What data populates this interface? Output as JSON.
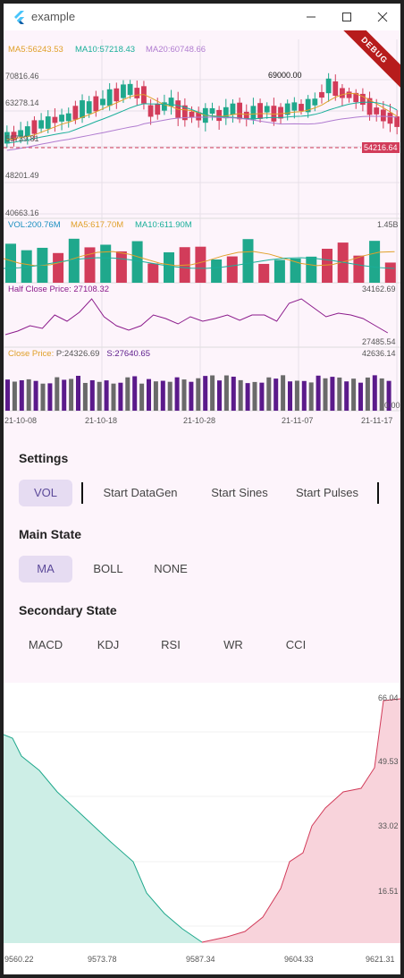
{
  "window": {
    "title": "example",
    "controls": [
      "minimize",
      "maximize",
      "close"
    ]
  },
  "debug_banner": "DEBUG",
  "main_chart": {
    "legend": [
      {
        "label": "MA5:56243.53",
        "color": "#e0a02a"
      },
      {
        "label": "MA10:57218.43",
        "color": "#1aaf9a"
      },
      {
        "label": "MA20:60748.66",
        "color": "#b07cd0"
      }
    ],
    "y_labels": [
      "70816.46",
      "63278.14",
      "55739.81",
      "48201.49",
      "40663.16"
    ],
    "high_label": "69000.00",
    "current_price": "54216.64",
    "colors": {
      "up": "#1fa88c",
      "down": "#d23c5a",
      "ma5": "#e0a02a",
      "ma10": "#1aaf9a",
      "ma20": "#b07cd0"
    }
  },
  "volume_chart": {
    "legend": [
      {
        "label": "VOL:200.76M",
        "color": "#1a8fc0"
      },
      {
        "label": "MA5:617.70M",
        "color": "#e0a02a"
      },
      {
        "label": "MA10:611.90M",
        "color": "#1aaf9a"
      }
    ],
    "max_label": "1.45B"
  },
  "half_close_chart": {
    "legend": "Half Close Price: 27108.32",
    "legend_color": "#8b1a8b",
    "max_label": "34162.69",
    "min_label": "27485.54"
  },
  "close_chart": {
    "legend": {
      "prefix": "Close Price: ",
      "p": "P:24326.69",
      "s": "S:27640.65",
      "p_color": "#555555",
      "s_color": "#5b1a8b"
    },
    "max_label": "42636.14",
    "min_label": "0.00"
  },
  "dates": [
    "21-10-08",
    "21-10-18",
    "21-10-28",
    "21-11-07",
    "21-11-17"
  ],
  "settings": {
    "title": "Settings",
    "buttons": [
      {
        "label": "VOL",
        "selected": true
      },
      {
        "label": "Start DataGen",
        "selected": false
      },
      {
        "label": "Start Sines",
        "selected": false
      },
      {
        "label": "Start Pulses",
        "selected": false
      }
    ]
  },
  "main_state": {
    "title": "Main State",
    "buttons": [
      {
        "label": "MA",
        "selected": true
      },
      {
        "label": "BOLL",
        "selected": false
      },
      {
        "label": "NONE",
        "selected": false
      }
    ]
  },
  "secondary_state": {
    "title": "Secondary State",
    "buttons": [
      {
        "label": "MACD",
        "selected": false
      },
      {
        "label": "KDJ",
        "selected": false
      },
      {
        "label": "RSI",
        "selected": false
      },
      {
        "label": "WR",
        "selected": false
      },
      {
        "label": "CCI",
        "selected": false
      }
    ]
  },
  "depth_chart": {
    "y_labels": [
      "66.04",
      "49.53",
      "33.02",
      "16.51"
    ],
    "x_labels": [
      "9560.22",
      "9573.78",
      "9587.34",
      "9604.33",
      "9621.31"
    ],
    "colors": {
      "bid_line": "#1fa88c",
      "bid_fill": "#cdeee6",
      "ask_line": "#d23c5a",
      "ask_fill": "#f8d3db"
    }
  }
}
